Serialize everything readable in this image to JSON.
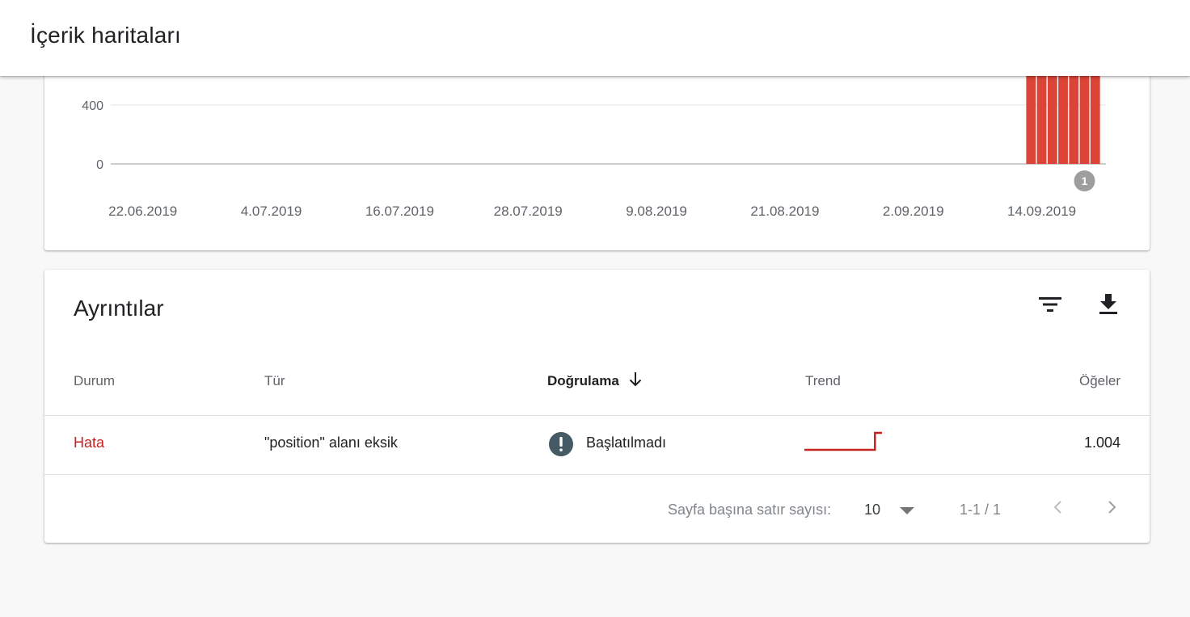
{
  "header": {
    "title": "İçerik haritaları"
  },
  "chart_data": {
    "type": "bar",
    "y_ticks": [
      0,
      400
    ],
    "x_tick_labels": [
      "22.06.2019",
      "4.07.2019",
      "16.07.2019",
      "28.07.2019",
      "9.08.2019",
      "21.08.2019",
      "2.09.2019",
      "14.09.2019"
    ],
    "x_start": "2019-06-19",
    "x_end": "2019-09-20",
    "bars": [
      {
        "date": "2019-09-13",
        "value": 1004
      },
      {
        "date": "2019-09-14",
        "value": 1004
      },
      {
        "date": "2019-09-15",
        "value": 1004
      },
      {
        "date": "2019-09-16",
        "value": 1004
      },
      {
        "date": "2019-09-17",
        "value": 1004
      },
      {
        "date": "2019-09-18",
        "value": 1004
      },
      {
        "date": "2019-09-19",
        "value": 1004
      }
    ],
    "annotation": {
      "label": "1",
      "date": "2019-09-18"
    },
    "bar_color": "#db4437",
    "grid": true
  },
  "details": {
    "title": "Ayrıntılar",
    "columns": {
      "status": "Durum",
      "type": "Tür",
      "validation": "Doğrulama",
      "trend": "Trend",
      "items": "Öğeler"
    },
    "rows": [
      {
        "status": "Hata",
        "type": "\"position\" alanı eksik",
        "validation": "Başlatılmadı",
        "items": "1.004",
        "trend": [
          0,
          0,
          0,
          0,
          0,
          0,
          0,
          0,
          0,
          0,
          1,
          1
        ]
      }
    ],
    "pagination": {
      "rows_per_page_label": "Sayfa başına satır sayısı:",
      "rows_per_page_value": "10",
      "range": "1-1 / 1"
    }
  },
  "colors": {
    "error": "#c5221f",
    "bar": "#db4437",
    "trend": "#c5221f",
    "alert_icon": "#455a64"
  }
}
